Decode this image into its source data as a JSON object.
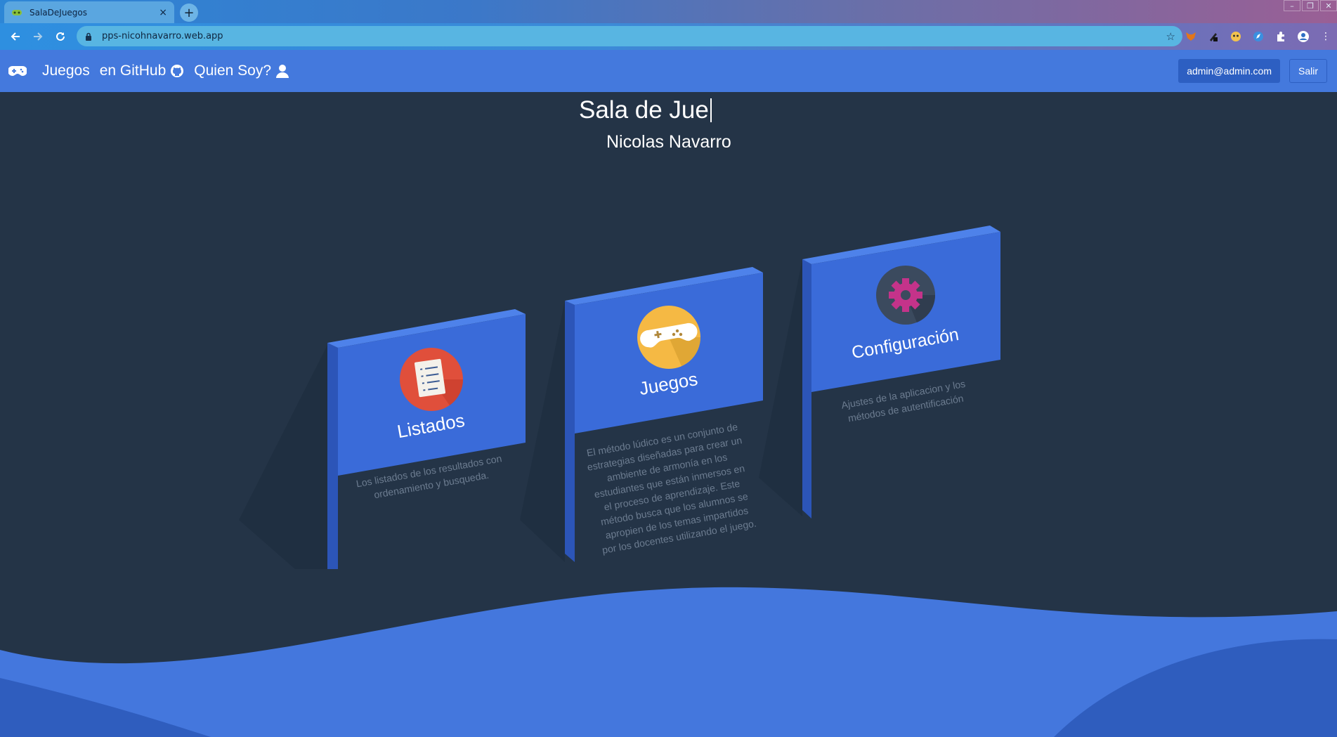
{
  "browser": {
    "tab_title": "SalaDeJuegos",
    "tab_close": "×",
    "new_tab": "+",
    "url": "pps-nicohnavarro.web.app"
  },
  "navbar": {
    "brand_icon": "gamepad-icon",
    "links": [
      {
        "label": "Juegos"
      },
      {
        "label": "en GitHub",
        "icon": "github-icon"
      },
      {
        "label": "Quien Soy?",
        "icon": "user-icon"
      }
    ],
    "user_email": "admin@admin.com",
    "logout_label": "Salir"
  },
  "hero": {
    "title": "Sala de Jue",
    "subtitle": "Nicolas Navarro"
  },
  "cards": [
    {
      "label": "Listados",
      "icon": "checklist-icon",
      "description_lines": [
        "Los listados de los resultados con",
        "ordenamiento y busqueda."
      ]
    },
    {
      "label": "Juegos",
      "icon": "gamepad-icon",
      "description_lines": [
        "El método lúdico es un conjunto de",
        "estrategias diseñadas para crear un",
        "ambiente de armonía en los",
        "estudiantes que están inmersos en",
        "el proceso de aprendizaje. Este",
        "método busca que los alumnos se",
        "apropien de los temas impartidos",
        "por los docentes utilizando el juego."
      ]
    },
    {
      "label": "Configuración",
      "icon": "gear-icon",
      "description_lines": [
        "Ajustes de la aplicacion y los",
        "métodos de autentificación"
      ]
    }
  ],
  "colors": {
    "background": "#243447",
    "navbar": "#4479dd",
    "card_face": "#3a6bd9",
    "card_side": "#2c55b8"
  }
}
